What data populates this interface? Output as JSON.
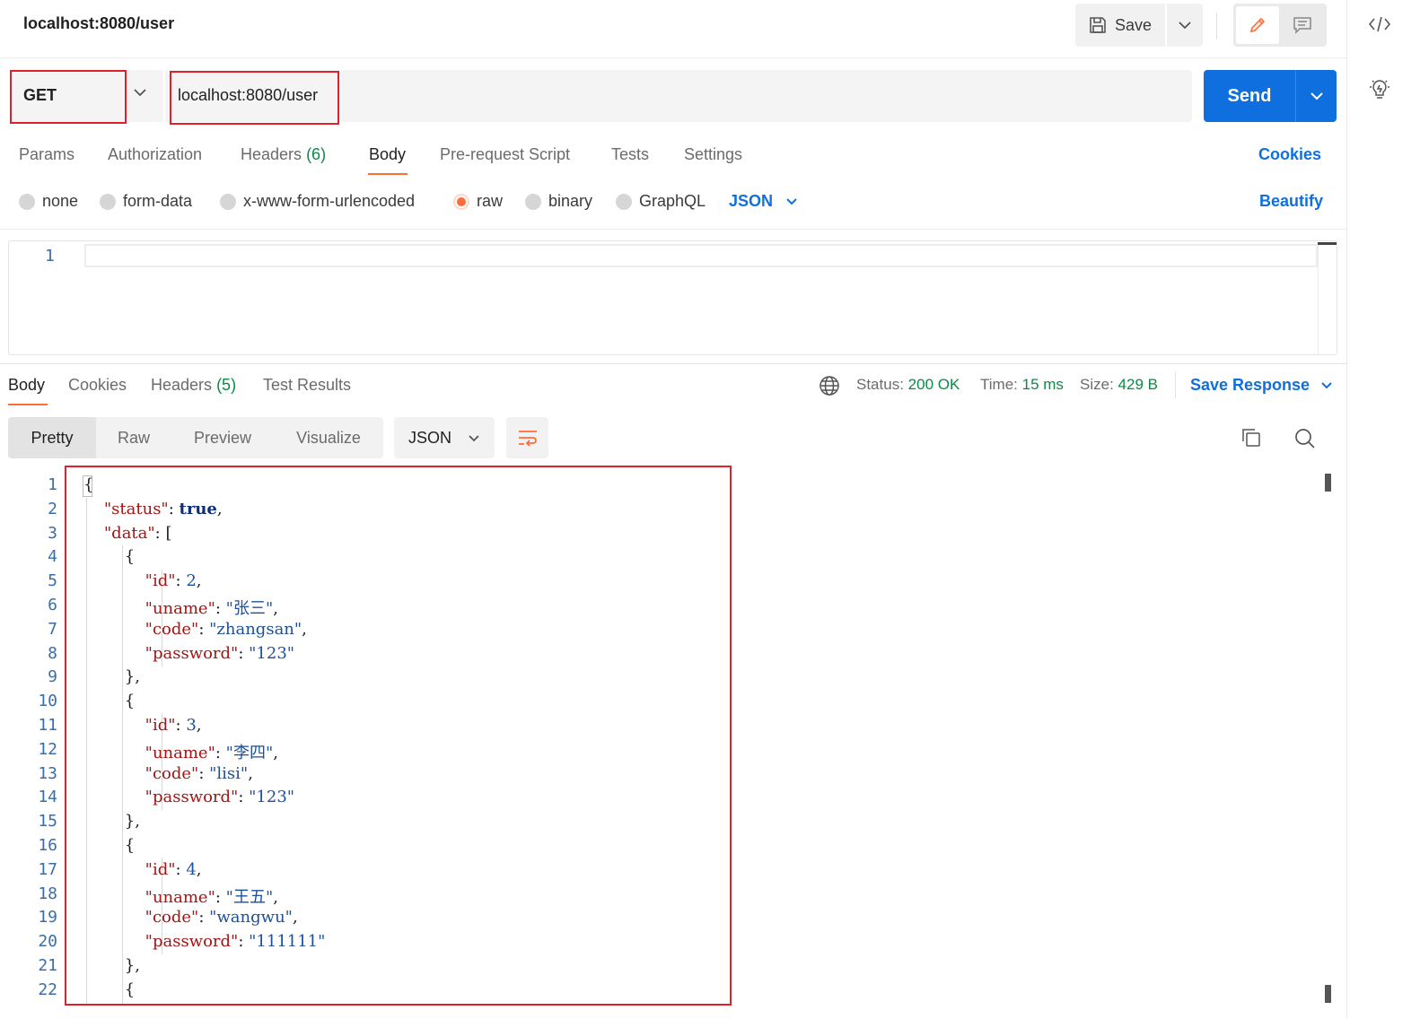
{
  "header": {
    "title": "localhost:8080/user",
    "save_label": "Save"
  },
  "request": {
    "method": "GET",
    "url": "localhost:8080/user",
    "send_label": "Send",
    "tabs": [
      {
        "label": "Params"
      },
      {
        "label": "Authorization"
      },
      {
        "label": "Headers",
        "count": "(6)"
      },
      {
        "label": "Body"
      },
      {
        "label": "Pre-request Script"
      },
      {
        "label": "Tests"
      },
      {
        "label": "Settings"
      }
    ],
    "active_tab": "Body",
    "cookies_label": "Cookies",
    "body_types": [
      "none",
      "form-data",
      "x-www-form-urlencoded",
      "raw",
      "binary",
      "GraphQL"
    ],
    "selected_body_type": "raw",
    "language": "JSON",
    "beautify_label": "Beautify",
    "editor_line": "1"
  },
  "response": {
    "tabs": [
      {
        "label": "Body"
      },
      {
        "label": "Cookies"
      },
      {
        "label": "Headers",
        "count": "(5)"
      },
      {
        "label": "Test Results"
      }
    ],
    "active_tab": "Body",
    "status_label": "Status:",
    "status_value": "200 OK",
    "time_label": "Time:",
    "time_value": "15 ms",
    "size_label": "Size:",
    "size_value": "429 B",
    "save_response_label": "Save Response",
    "views": [
      "Pretty",
      "Raw",
      "Preview",
      "Visualize"
    ],
    "active_view": "Pretty",
    "format": "JSON",
    "lines": [
      {
        "n": "1",
        "t": "{"
      },
      {
        "n": "2",
        "t": "    \"status\": true,"
      },
      {
        "n": "3",
        "t": "    \"data\": ["
      },
      {
        "n": "4",
        "t": "        {"
      },
      {
        "n": "5",
        "t": "            \"id\": 2,"
      },
      {
        "n": "6",
        "t": "            \"uname\": \"张三\","
      },
      {
        "n": "7",
        "t": "            \"code\": \"zhangsan\","
      },
      {
        "n": "8",
        "t": "            \"password\": \"123\""
      },
      {
        "n": "9",
        "t": "        },"
      },
      {
        "n": "10",
        "t": "        {"
      },
      {
        "n": "11",
        "t": "            \"id\": 3,"
      },
      {
        "n": "12",
        "t": "            \"uname\": \"李四\","
      },
      {
        "n": "13",
        "t": "            \"code\": \"lisi\","
      },
      {
        "n": "14",
        "t": "            \"password\": \"123\""
      },
      {
        "n": "15",
        "t": "        },"
      },
      {
        "n": "16",
        "t": "        {"
      },
      {
        "n": "17",
        "t": "            \"id\": 4,"
      },
      {
        "n": "18",
        "t": "            \"uname\": \"王五\","
      },
      {
        "n": "19",
        "t": "            \"code\": \"wangwu\","
      },
      {
        "n": "20",
        "t": "            \"password\": \"111111\""
      },
      {
        "n": "21",
        "t": "        },"
      },
      {
        "n": "22",
        "t": "        {"
      }
    ]
  },
  "colors": {
    "accent_blue": "#0f6fde",
    "accent_orange": "#ff6c37",
    "highlight_red": "#e0212d",
    "status_green": "#0a8a45"
  },
  "icons": [
    "save-icon",
    "chevron-down-icon",
    "edit-pencil-icon",
    "comment-icon",
    "code-icon",
    "lightbulb-icon",
    "globe-icon",
    "wrap-lines-icon",
    "copy-icon",
    "search-icon"
  ]
}
